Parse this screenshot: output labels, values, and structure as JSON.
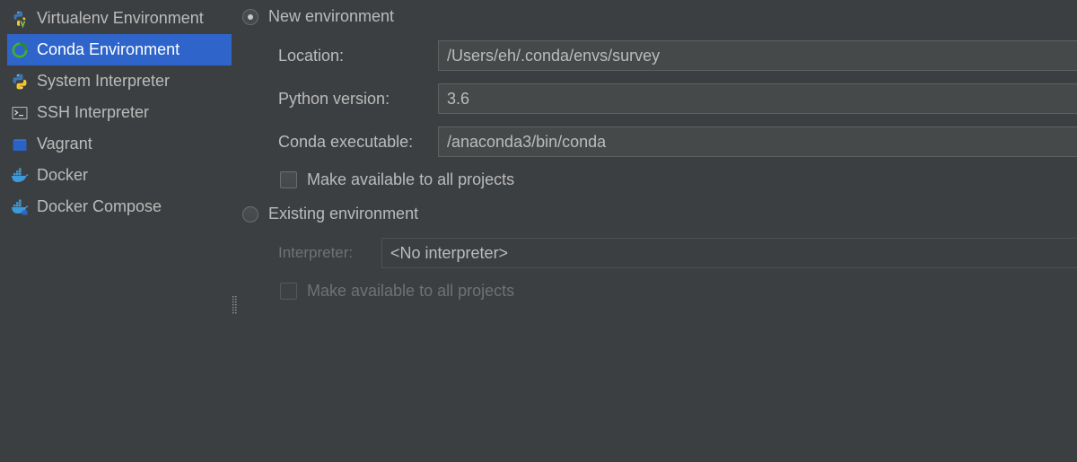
{
  "sidebar": {
    "items": [
      {
        "label": "Virtualenv Environment",
        "icon": "python-virtualenv-icon"
      },
      {
        "label": "Conda Environment",
        "icon": "conda-icon",
        "selected": true
      },
      {
        "label": "System Interpreter",
        "icon": "python-icon"
      },
      {
        "label": "SSH Interpreter",
        "icon": "terminal-icon"
      },
      {
        "label": "Vagrant",
        "icon": "vagrant-icon"
      },
      {
        "label": "Docker",
        "icon": "docker-icon"
      },
      {
        "label": "Docker Compose",
        "icon": "docker-compose-icon"
      }
    ]
  },
  "new_env": {
    "radio_label": "New environment",
    "selected": true,
    "location_label": "Location:",
    "location_value": "/Users/eh/.conda/envs/survey",
    "python_version_label": "Python version:",
    "python_version_value": "3.6",
    "conda_exec_label": "Conda executable:",
    "conda_exec_value": "/anaconda3/bin/conda",
    "make_available_label": "Make available to all projects"
  },
  "existing_env": {
    "radio_label": "Existing environment",
    "selected": false,
    "interpreter_label": "Interpreter:",
    "interpreter_value": "<No interpreter>",
    "make_available_label": "Make available to all projects"
  },
  "colors": {
    "background": "#3c3f41",
    "selection": "#2f65ca",
    "text": "#bbbbbb",
    "disabled_text": "#6f7275",
    "field_background": "#45494a"
  }
}
